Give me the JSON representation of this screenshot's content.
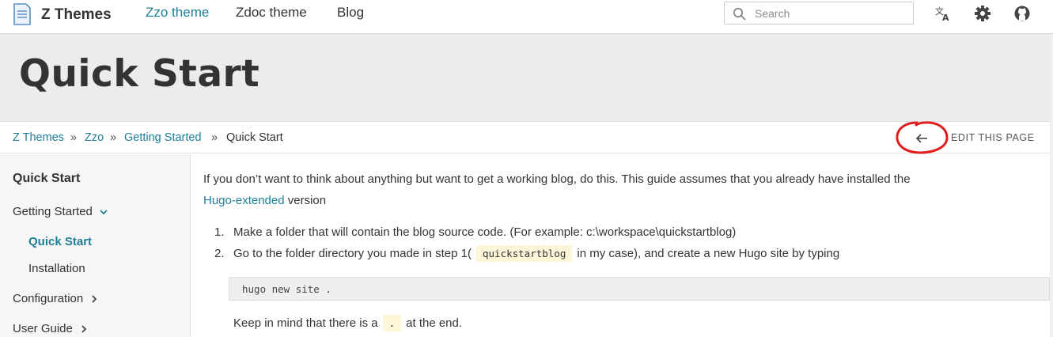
{
  "navbar": {
    "brand": "Z Themes",
    "links": [
      "Zzo theme",
      "Zdoc theme",
      "Blog"
    ],
    "search_placeholder": "Search",
    "icons": [
      "translate-icon",
      "gear-icon",
      "github-icon"
    ]
  },
  "hero": {
    "title": "Quick Start"
  },
  "breadcrumb": {
    "items": [
      "Z Themes",
      "Zzo",
      "Getting Started",
      "Quick Start"
    ],
    "separator": "»",
    "edit_label": "EDIT THIS PAGE"
  },
  "sidebar": {
    "title": "Quick Start",
    "sections": [
      {
        "label": "Getting Started",
        "expanded": true
      },
      {
        "label": "Configuration",
        "expanded": false
      },
      {
        "label": "User Guide",
        "expanded": false
      }
    ],
    "subitems": [
      "Quick Start",
      "Installation"
    ]
  },
  "content": {
    "intro_text": "If you don’t want to think about anything but want to get a working blog, do this. This guide assumes that you already have installed the",
    "intro_link": "Hugo-extended",
    "intro_suffix": "version",
    "steps": [
      {
        "num": "1.",
        "text": "Make a folder that will contain the blog source code. (For example: c:\\workspace\\quickstartblog)"
      },
      {
        "num": "2.",
        "text_before": "Go to the folder directory you made in step 1(",
        "code": "quickstartblog",
        "text_after": "in my case), and create a new Hugo site by typing"
      }
    ],
    "code_block": "hugo new site .",
    "note_before": "Keep in mind that there is a",
    "note_code": ".",
    "note_after": "at the end."
  },
  "colors": {
    "accent": "#1e7e96",
    "annotation_red": "#e01e1e"
  }
}
